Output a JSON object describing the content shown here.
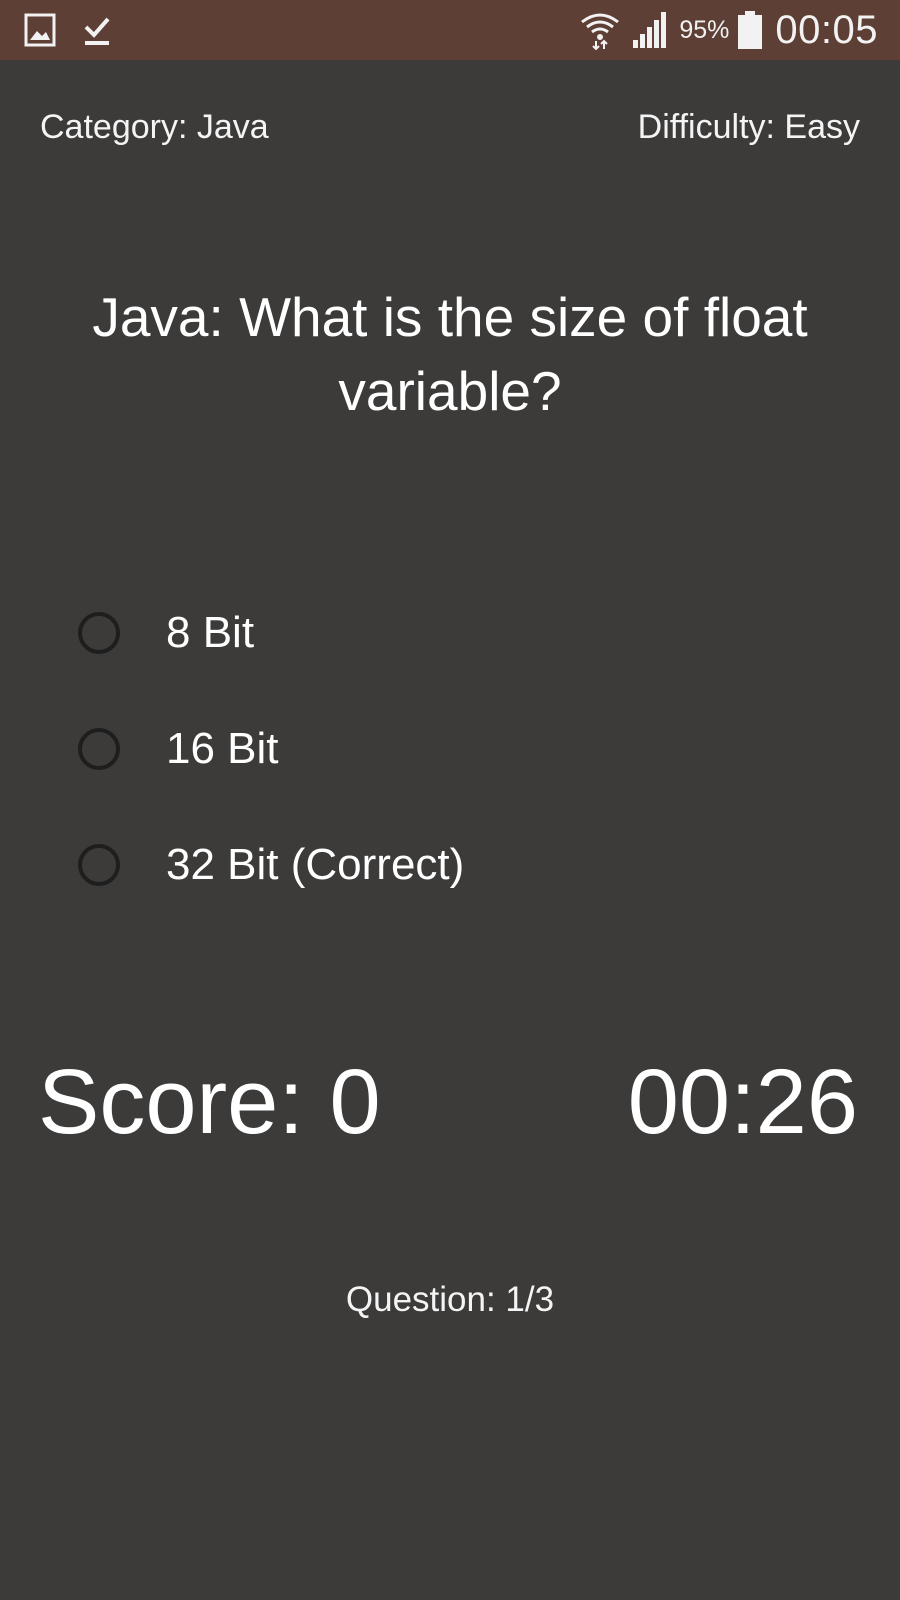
{
  "status_bar": {
    "left_icons": [
      "gallery-icon",
      "download-done-icon"
    ],
    "right_icons": [
      "wifi-icon",
      "signal-icon",
      "battery-icon"
    ],
    "battery_percent": "95%",
    "clock": "00:05"
  },
  "quiz": {
    "category": "Category: Java",
    "difficulty": "Difficulty: Easy",
    "question": "Java: What is the size of float variable?",
    "options": [
      {
        "label": "8 Bit"
      },
      {
        "label": "16 Bit"
      },
      {
        "label": "32 Bit (Correct)"
      }
    ],
    "score": "Score: 0",
    "timer": "00:26",
    "progress": "Question: 1/3"
  },
  "colors": {
    "background": "#3c3b3a",
    "status_bar": "#5d3f35",
    "text": "#ffffff",
    "radio_border": "#1e1e1e"
  }
}
